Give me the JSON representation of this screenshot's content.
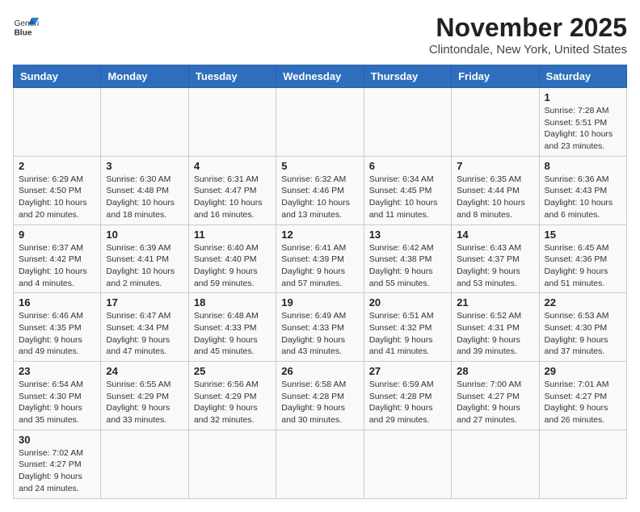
{
  "header": {
    "logo_text_normal": "General",
    "logo_text_bold": "Blue",
    "title": "November 2025",
    "subtitle": "Clintondale, New York, United States"
  },
  "weekdays": [
    "Sunday",
    "Monday",
    "Tuesday",
    "Wednesday",
    "Thursday",
    "Friday",
    "Saturday"
  ],
  "weeks": [
    [
      null,
      null,
      null,
      null,
      null,
      null,
      {
        "day": 1,
        "sunrise": "7:28 AM",
        "sunset": "5:51 PM",
        "daylight": "10 hours and 23 minutes."
      }
    ],
    [
      {
        "day": 2,
        "sunrise": "6:29 AM",
        "sunset": "4:50 PM",
        "daylight": "10 hours and 20 minutes."
      },
      {
        "day": 3,
        "sunrise": "6:30 AM",
        "sunset": "4:48 PM",
        "daylight": "10 hours and 18 minutes."
      },
      {
        "day": 4,
        "sunrise": "6:31 AM",
        "sunset": "4:47 PM",
        "daylight": "10 hours and 16 minutes."
      },
      {
        "day": 5,
        "sunrise": "6:32 AM",
        "sunset": "4:46 PM",
        "daylight": "10 hours and 13 minutes."
      },
      {
        "day": 6,
        "sunrise": "6:34 AM",
        "sunset": "4:45 PM",
        "daylight": "10 hours and 11 minutes."
      },
      {
        "day": 7,
        "sunrise": "6:35 AM",
        "sunset": "4:44 PM",
        "daylight": "10 hours and 8 minutes."
      },
      {
        "day": 8,
        "sunrise": "6:36 AM",
        "sunset": "4:43 PM",
        "daylight": "10 hours and 6 minutes."
      }
    ],
    [
      {
        "day": 9,
        "sunrise": "6:37 AM",
        "sunset": "4:42 PM",
        "daylight": "10 hours and 4 minutes."
      },
      {
        "day": 10,
        "sunrise": "6:39 AM",
        "sunset": "4:41 PM",
        "daylight": "10 hours and 2 minutes."
      },
      {
        "day": 11,
        "sunrise": "6:40 AM",
        "sunset": "4:40 PM",
        "daylight": "9 hours and 59 minutes."
      },
      {
        "day": 12,
        "sunrise": "6:41 AM",
        "sunset": "4:39 PM",
        "daylight": "9 hours and 57 minutes."
      },
      {
        "day": 13,
        "sunrise": "6:42 AM",
        "sunset": "4:38 PM",
        "daylight": "9 hours and 55 minutes."
      },
      {
        "day": 14,
        "sunrise": "6:43 AM",
        "sunset": "4:37 PM",
        "daylight": "9 hours and 53 minutes."
      },
      {
        "day": 15,
        "sunrise": "6:45 AM",
        "sunset": "4:36 PM",
        "daylight": "9 hours and 51 minutes."
      }
    ],
    [
      {
        "day": 16,
        "sunrise": "6:46 AM",
        "sunset": "4:35 PM",
        "daylight": "9 hours and 49 minutes."
      },
      {
        "day": 17,
        "sunrise": "6:47 AM",
        "sunset": "4:34 PM",
        "daylight": "9 hours and 47 minutes."
      },
      {
        "day": 18,
        "sunrise": "6:48 AM",
        "sunset": "4:33 PM",
        "daylight": "9 hours and 45 minutes."
      },
      {
        "day": 19,
        "sunrise": "6:49 AM",
        "sunset": "4:33 PM",
        "daylight": "9 hours and 43 minutes."
      },
      {
        "day": 20,
        "sunrise": "6:51 AM",
        "sunset": "4:32 PM",
        "daylight": "9 hours and 41 minutes."
      },
      {
        "day": 21,
        "sunrise": "6:52 AM",
        "sunset": "4:31 PM",
        "daylight": "9 hours and 39 minutes."
      },
      {
        "day": 22,
        "sunrise": "6:53 AM",
        "sunset": "4:30 PM",
        "daylight": "9 hours and 37 minutes."
      }
    ],
    [
      {
        "day": 23,
        "sunrise": "6:54 AM",
        "sunset": "4:30 PM",
        "daylight": "9 hours and 35 minutes."
      },
      {
        "day": 24,
        "sunrise": "6:55 AM",
        "sunset": "4:29 PM",
        "daylight": "9 hours and 33 minutes."
      },
      {
        "day": 25,
        "sunrise": "6:56 AM",
        "sunset": "4:29 PM",
        "daylight": "9 hours and 32 minutes."
      },
      {
        "day": 26,
        "sunrise": "6:58 AM",
        "sunset": "4:28 PM",
        "daylight": "9 hours and 30 minutes."
      },
      {
        "day": 27,
        "sunrise": "6:59 AM",
        "sunset": "4:28 PM",
        "daylight": "9 hours and 29 minutes."
      },
      {
        "day": 28,
        "sunrise": "7:00 AM",
        "sunset": "4:27 PM",
        "daylight": "9 hours and 27 minutes."
      },
      {
        "day": 29,
        "sunrise": "7:01 AM",
        "sunset": "4:27 PM",
        "daylight": "9 hours and 26 minutes."
      }
    ],
    [
      {
        "day": 30,
        "sunrise": "7:02 AM",
        "sunset": "4:27 PM",
        "daylight": "9 hours and 24 minutes."
      },
      null,
      null,
      null,
      null,
      null,
      null
    ]
  ]
}
